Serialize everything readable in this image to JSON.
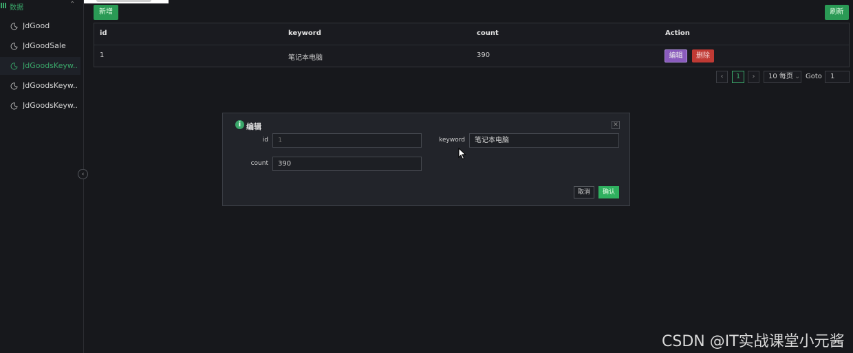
{
  "sidebar": {
    "group": {
      "label": "数据"
    },
    "items": [
      {
        "label": "JdGood"
      },
      {
        "label": "JdGoodSale"
      },
      {
        "label": "JdGoodsKeyw..."
      },
      {
        "label": "JdGoodsKeyw..."
      },
      {
        "label": "JdGoodsKeyw..."
      }
    ]
  },
  "toolbar": {
    "add_label": "新增",
    "refresh_label": "刷新"
  },
  "table": {
    "columns": [
      "id",
      "keyword",
      "count",
      "Action"
    ],
    "rows": [
      {
        "id": "1",
        "keyword": "笔记本电脑",
        "count": "390"
      }
    ],
    "actions": {
      "edit": "编辑",
      "delete": "删除"
    }
  },
  "pagination": {
    "prev": "‹",
    "current": "1",
    "next": "›",
    "page_size": "10 每页",
    "goto_label": "Goto",
    "goto_value": "1"
  },
  "modal": {
    "title": "编辑",
    "fields": {
      "id_label": "id",
      "id_value": "1",
      "keyword_label": "keyword",
      "keyword_value": "笔记本电脑",
      "count_label": "count",
      "count_value": "390"
    },
    "cancel_label": "取消",
    "ok_label": "确认"
  },
  "watermark": "CSDN @IT实战课堂小元酱",
  "colors": {
    "accent": "#3aa76a",
    "edit": "#8a5bbd",
    "delete": "#c03a34"
  }
}
